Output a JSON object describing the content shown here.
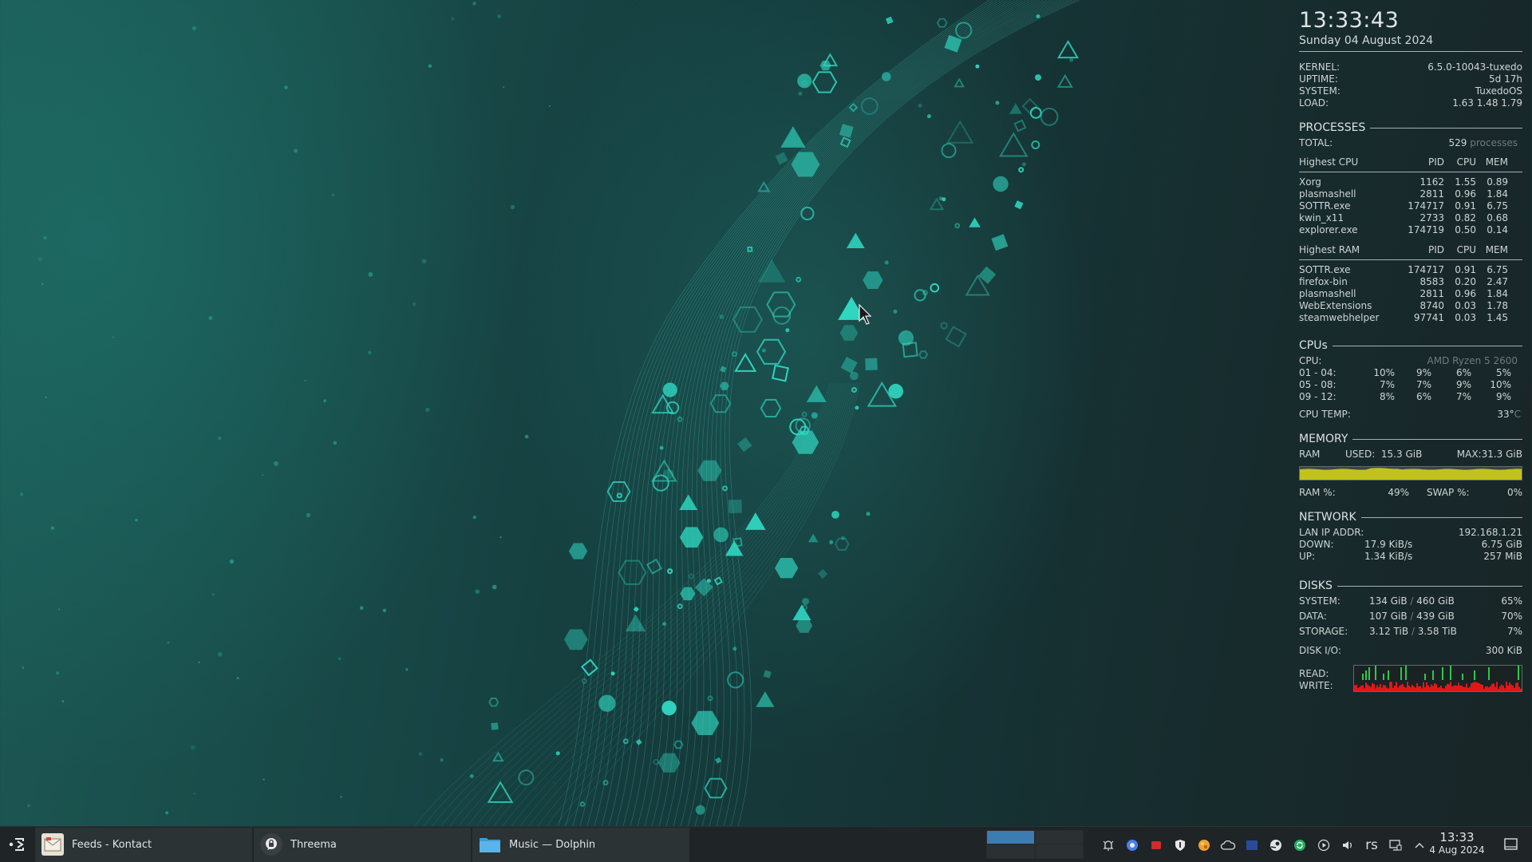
{
  "conky": {
    "time": "13:33:43",
    "date": "Sunday 04 August 2024",
    "system": [
      {
        "label": "KERNEL:",
        "value": "6.5.0-10043-tuxedo"
      },
      {
        "label": "UPTIME:",
        "value": "5d 17h"
      },
      {
        "label": "SYSTEM:",
        "value": "TuxedoOS"
      },
      {
        "label": "LOAD:",
        "value": "1.63 1.48 1.79"
      }
    ],
    "processes": {
      "heading": "PROCESSES",
      "total_label": "TOTAL:",
      "total_value": "529",
      "total_unit": "processes",
      "highest_cpu": {
        "title": "Highest CPU",
        "col_pid": "PID",
        "col_cpu": "CPU",
        "col_mem": "MEM",
        "rows": [
          {
            "name": "Xorg",
            "pid": "1162",
            "cpu": "1.55",
            "mem": "0.89"
          },
          {
            "name": "plasmashell",
            "pid": "2811",
            "cpu": "0.96",
            "mem": "1.84"
          },
          {
            "name": "SOTTR.exe",
            "pid": "174717",
            "cpu": "0.91",
            "mem": "6.75"
          },
          {
            "name": "kwin_x11",
            "pid": "2733",
            "cpu": "0.82",
            "mem": "0.68"
          },
          {
            "name": "explorer.exe",
            "pid": "174719",
            "cpu": "0.50",
            "mem": "0.14"
          }
        ]
      },
      "highest_ram": {
        "title": "Highest RAM",
        "col_pid": "PID",
        "col_cpu": "CPU",
        "col_mem": "MEM",
        "rows": [
          {
            "name": "SOTTR.exe",
            "pid": "174717",
            "cpu": "0.91",
            "mem": "6.75"
          },
          {
            "name": "firefox-bin",
            "pid": "8583",
            "cpu": "0.20",
            "mem": "2.47"
          },
          {
            "name": "plasmashell",
            "pid": "2811",
            "cpu": "0.96",
            "mem": "1.84"
          },
          {
            "name": "WebExtensions",
            "pid": "8740",
            "cpu": "0.03",
            "mem": "1.78"
          },
          {
            "name": "steamwebhelper",
            "pid": "97741",
            "cpu": "0.03",
            "mem": "1.45"
          }
        ]
      }
    },
    "cpus": {
      "heading": "CPUs",
      "cpu_label": "CPU:",
      "cpu_model": "AMD Ryzen 5 2600",
      "rows": [
        {
          "label": "01 - 04:",
          "v": [
            "10%",
            "9%",
            "6%",
            "5%"
          ]
        },
        {
          "label": "05 - 08:",
          "v": [
            "7%",
            "7%",
            "9%",
            "10%"
          ]
        },
        {
          "label": "09 - 12:",
          "v": [
            "8%",
            "6%",
            "7%",
            "9%"
          ]
        }
      ],
      "temp_label": "CPU TEMP:",
      "temp_value": "33°",
      "temp_unit": "C"
    },
    "memory": {
      "heading": "MEMORY",
      "ram_label": "RAM",
      "used_label": "USED:",
      "used_value": "15.3 GiB",
      "max_label": "MAX:",
      "max_value": "31.3 GiB",
      "ram_fraction": 0.49,
      "ram_pct_label": "RAM %:",
      "ram_pct_value": "49%",
      "swap_label": "SWAP %:",
      "swap_value": "0%",
      "bar_color": "#c2c21d"
    },
    "network": {
      "heading": "NETWORK",
      "lan_label": "LAN IP ADDR:",
      "lan_value": "192.168.1.21",
      "down_label": "DOWN:",
      "down_rate": "17.9 KiB/s",
      "down_total": "6.75 GiB",
      "up_label": "UP:",
      "up_rate": "1.34 KiB/s",
      "up_total": "257 MiB"
    },
    "disks": {
      "heading": "DISKS",
      "rows": [
        {
          "label": "SYSTEM:",
          "used": "134 GiB",
          "size": "460 GiB",
          "pct": "65%"
        },
        {
          "label": "DATA:",
          "used": "107 GiB",
          "size": "439 GiB",
          "pct": "70%"
        },
        {
          "label": "STORAGE:",
          "used": "3.12 TiB",
          "size": "3.58 TiB",
          "pct": "7%"
        }
      ],
      "io_label": "DISK I/O:",
      "io_value": "300 KiB",
      "read_label": "READ:",
      "write_label": "WRITE:",
      "read_color": "#2fc84a",
      "write_color": "#e01818"
    }
  },
  "taskbar": {
    "tasks": [
      {
        "label": "Feeds - Kontact",
        "icon": "kontact-icon"
      },
      {
        "label": "Threema",
        "icon": "threema-icon"
      },
      {
        "label": "Music — Dolphin",
        "icon": "dolphin-folder-icon"
      }
    ],
    "clock_time": "13:33",
    "clock_date": "4 Aug 2024",
    "tray_text": "rs",
    "accent": "#3d7cb0"
  }
}
